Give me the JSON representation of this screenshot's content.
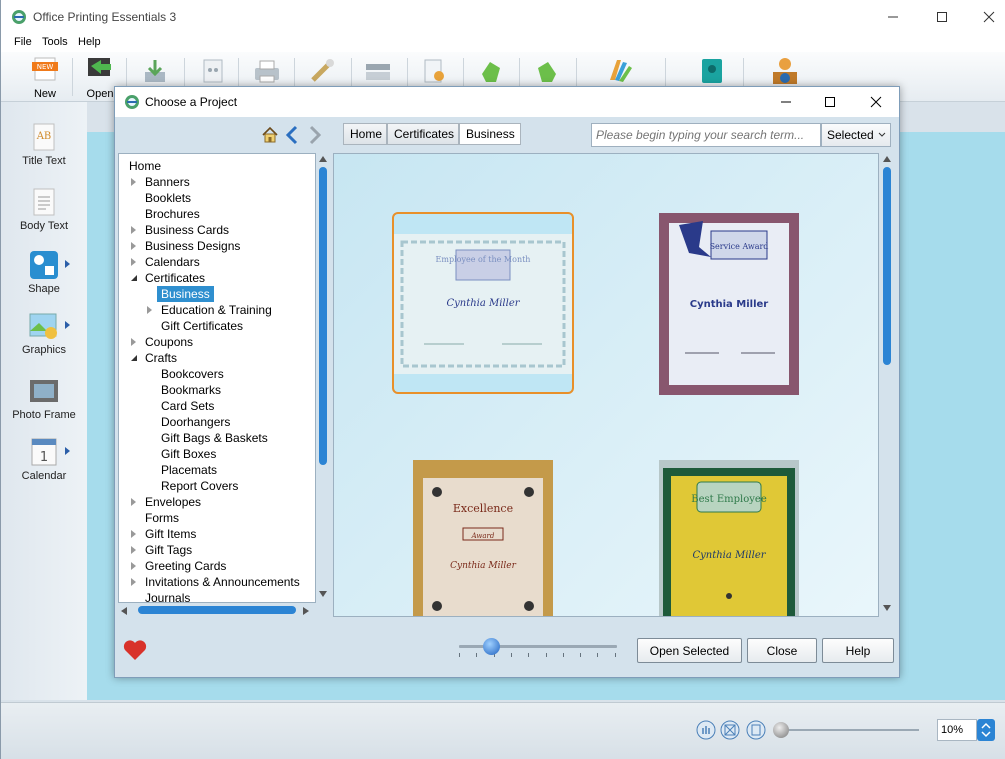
{
  "app": {
    "title": "Office Printing Essentials 3",
    "menu": [
      "File",
      "Tools",
      "Help"
    ],
    "ribbon": {
      "new_label": "New",
      "open_label": "Open"
    },
    "left_tools": [
      "Title Text",
      "Body Text",
      "Shape",
      "Graphics",
      "Photo Frame",
      "Calendar"
    ],
    "zoom_value": "10%"
  },
  "dialog": {
    "title": "Choose a Project",
    "breadcrumbs": [
      "Home",
      "Certificates",
      "Business"
    ],
    "search_placeholder": "Please begin typing your search term...",
    "search_scope": "Selected",
    "tree": [
      {
        "label": "Home",
        "level": 0,
        "expander": "none"
      },
      {
        "label": "Banners",
        "level": 1,
        "expander": "closed"
      },
      {
        "label": "Booklets",
        "level": 1,
        "expander": "none"
      },
      {
        "label": "Brochures",
        "level": 1,
        "expander": "none"
      },
      {
        "label": "Business Cards",
        "level": 1,
        "expander": "closed"
      },
      {
        "label": "Business Designs",
        "level": 1,
        "expander": "closed"
      },
      {
        "label": "Calendars",
        "level": 1,
        "expander": "closed"
      },
      {
        "label": "Certificates",
        "level": 1,
        "expander": "open"
      },
      {
        "label": "Business",
        "level": 2,
        "expander": "none",
        "selected": true
      },
      {
        "label": "Education & Training",
        "level": 2,
        "expander": "closed"
      },
      {
        "label": "Gift Certificates",
        "level": 2,
        "expander": "none"
      },
      {
        "label": "Coupons",
        "level": 1,
        "expander": "closed"
      },
      {
        "label": "Crafts",
        "level": 1,
        "expander": "open"
      },
      {
        "label": "Bookcovers",
        "level": 2,
        "expander": "none"
      },
      {
        "label": "Bookmarks",
        "level": 2,
        "expander": "none"
      },
      {
        "label": "Card Sets",
        "level": 2,
        "expander": "none"
      },
      {
        "label": "Doorhangers",
        "level": 2,
        "expander": "none"
      },
      {
        "label": "Gift Bags & Baskets",
        "level": 2,
        "expander": "none"
      },
      {
        "label": "Gift Boxes",
        "level": 2,
        "expander": "none"
      },
      {
        "label": "Placemats",
        "level": 2,
        "expander": "none"
      },
      {
        "label": "Report Covers",
        "level": 2,
        "expander": "none"
      },
      {
        "label": "Envelopes",
        "level": 1,
        "expander": "closed"
      },
      {
        "label": "Forms",
        "level": 1,
        "expander": "none"
      },
      {
        "label": "Gift Items",
        "level": 1,
        "expander": "closed"
      },
      {
        "label": "Gift Tags",
        "level": 1,
        "expander": "closed"
      },
      {
        "label": "Greeting Cards",
        "level": 1,
        "expander": "closed"
      },
      {
        "label": "Invitations & Announcements",
        "level": 1,
        "expander": "closed"
      },
      {
        "label": "Journals",
        "level": 1,
        "expander": "none"
      }
    ],
    "thumbnails": [
      {
        "title": "Employee of the Month",
        "name": "Cynthia Miller",
        "bg": "#e6f1f3",
        "accent": "#7a8fc0",
        "selected": true
      },
      {
        "title": "Service Award",
        "name": "Cynthia Miller",
        "bg": "#e9edf5",
        "accent": "#2a3a8a",
        "selected": false
      },
      {
        "title": "Excellence",
        "subtitle": "Award",
        "name": "Cynthia Miller",
        "bg": "#e8dccd",
        "accent": "#7a2a1a",
        "selected": false
      },
      {
        "title": "Best Employee",
        "name": "Cynthia Miller",
        "bg": "#e0c836",
        "accent": "#2f7a4a",
        "selected": false
      }
    ],
    "buttons": {
      "open": "Open Selected",
      "close": "Close",
      "help": "Help"
    },
    "thumb_size_level": 0.2
  }
}
